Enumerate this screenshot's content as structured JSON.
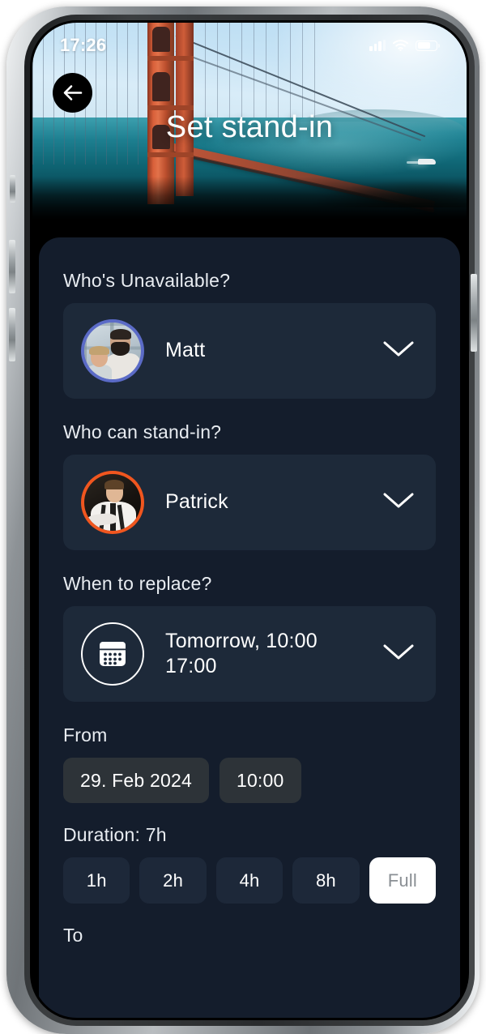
{
  "status_bar": {
    "time": "17:26",
    "signal_icon": "cellular-signal-icon",
    "wifi_icon": "wifi-icon",
    "battery_icon": "battery-icon",
    "battery_level_pct": 72
  },
  "header": {
    "back_icon": "arrow-left-icon",
    "title": "Set stand-in",
    "hero_image": "golden-gate-bridge-photo"
  },
  "form": {
    "unavailable": {
      "label": "Who's Unavailable?",
      "value": "Matt",
      "avatar_ring_color": "#5b6bc7",
      "chevron_icon": "chevron-down-icon"
    },
    "standin": {
      "label": "Who can stand-in?",
      "value": "Patrick",
      "avatar_ring_color": "#f0561f",
      "chevron_icon": "chevron-down-icon"
    },
    "when": {
      "label": "When to replace?",
      "value_line1": "Tomorrow, 10:00",
      "value_line2": "17:00",
      "icon": "calendar-icon",
      "chevron_icon": "chevron-down-icon"
    },
    "from": {
      "label": "From",
      "date": "29. Feb 2024",
      "time": "10:00"
    },
    "duration": {
      "label": "Duration: 7h",
      "options": [
        {
          "label": "1h",
          "selected": false
        },
        {
          "label": "2h",
          "selected": false
        },
        {
          "label": "4h",
          "selected": false
        },
        {
          "label": "8h",
          "selected": false
        },
        {
          "label": "Full",
          "selected": true
        }
      ]
    },
    "to": {
      "label": "To"
    }
  },
  "theme": {
    "panel_bg": "#141d2c",
    "card_bg": "#1d2939",
    "pill_bg": "#2d3338",
    "chip_bg": "#1d2839",
    "chip_selected_bg": "#ffffff",
    "chip_selected_text": "#8a8f94",
    "text_primary": "#ffffff"
  }
}
